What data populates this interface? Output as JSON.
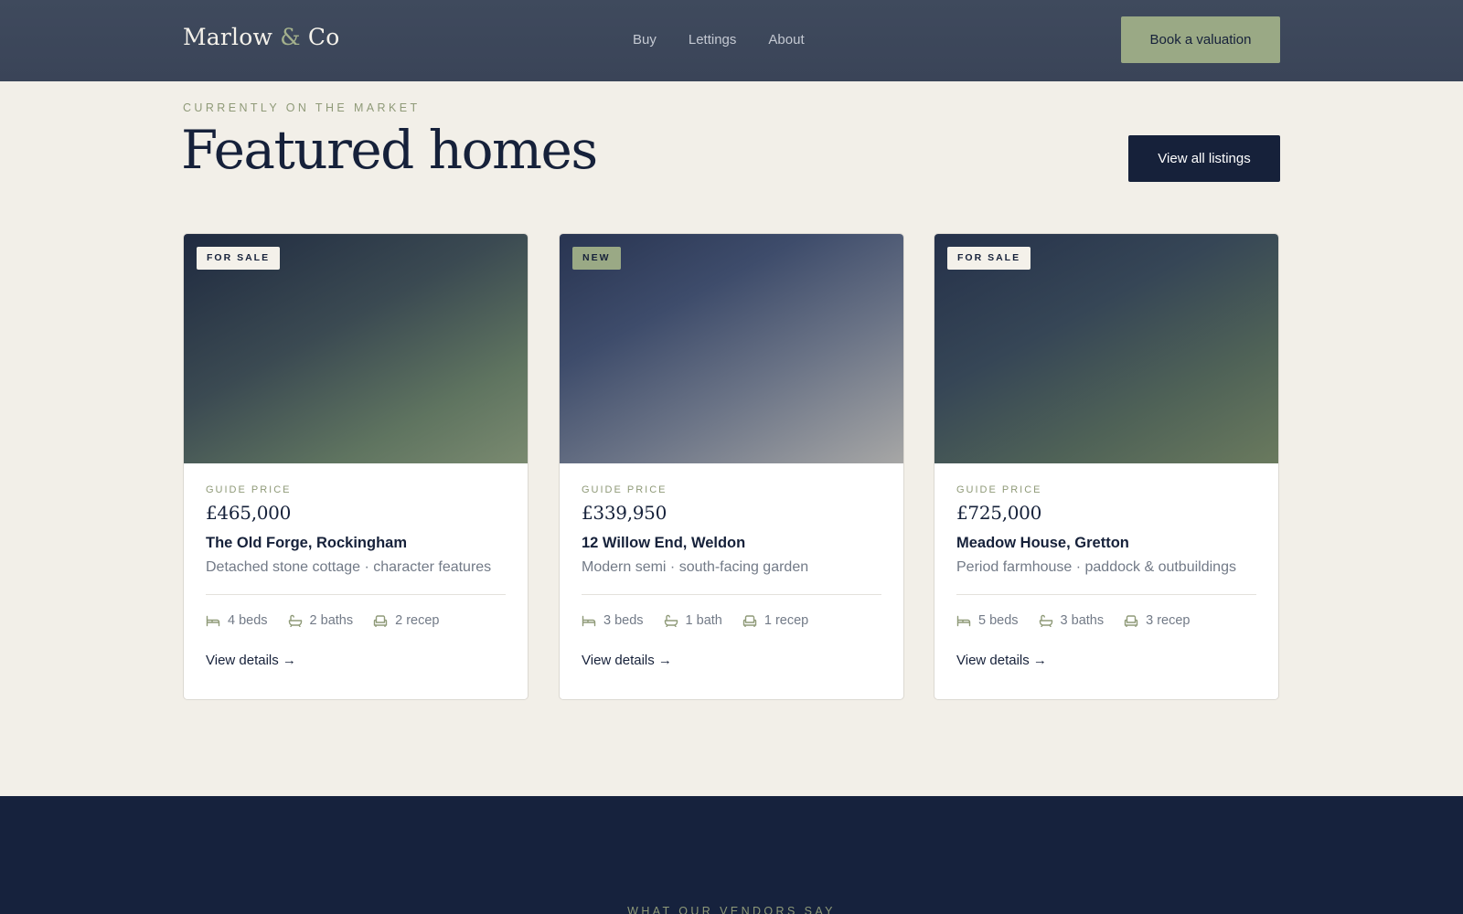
{
  "header": {
    "logo_main": "Marlow ",
    "logo_amp": "&",
    "logo_end": " Co",
    "nav": [
      {
        "label": "Buy"
      },
      {
        "label": "Lettings"
      },
      {
        "label": "About"
      }
    ],
    "cta_label": "Book a valuation"
  },
  "featured": {
    "eyebrow": "CURRENTLY ON THE MARKET",
    "title": "Featured homes",
    "view_all_label": "View all listings"
  },
  "colors": {
    "navy": "#16213a",
    "sage": "#9aa985",
    "cream": "#f2efe8"
  },
  "cards": [
    {
      "badge": "FOR SALE",
      "guide_label": "GUIDE PRICE",
      "price": "£465,000",
      "name": "The Old Forge, Rockingham",
      "description": "Detached stone cottage · character features",
      "beds": "4 beds",
      "baths": "2 baths",
      "recep": "2 recep",
      "link": "View details →"
    },
    {
      "badge": "NEW",
      "guide_label": "GUIDE PRICE",
      "price": "£339,950",
      "name": "12 Willow End, Weldon",
      "description": "Modern semi · south-facing garden",
      "beds": "3 beds",
      "baths": "1 bath",
      "recep": "1 recep",
      "link": "View details →"
    },
    {
      "badge": "FOR SALE",
      "guide_label": "GUIDE PRICE",
      "price": "£725,000",
      "name": "Meadow House, Gretton",
      "description": "Period farmhouse · paddock & outbuildings",
      "beds": "5 beds",
      "baths": "3 baths",
      "recep": "3 recep",
      "link": "View details →"
    }
  ],
  "testimonials": {
    "eyebrow": "WHAT OUR VENDORS SAY"
  }
}
